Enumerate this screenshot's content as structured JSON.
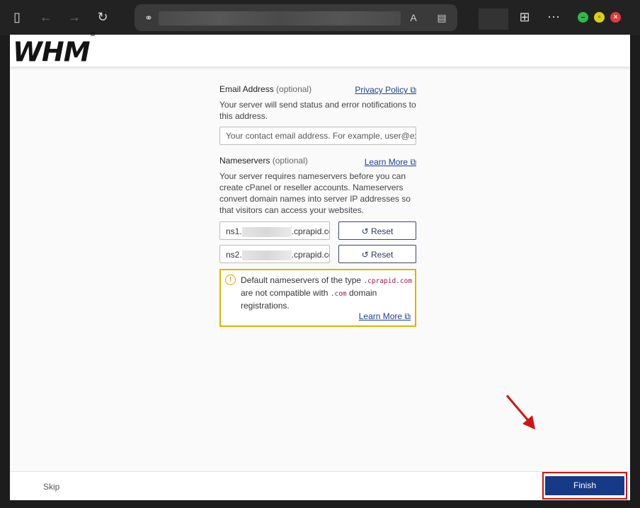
{
  "colors": {
    "accent": "#163a86",
    "link": "#1d3f8e",
    "warning_border": "#e0b100",
    "annotation_red": "#d21414"
  },
  "chrome": {
    "icons": [
      "sidebar-icon",
      "back-icon",
      "forward-icon",
      "refresh-icon",
      "link-icon",
      "translate-icon",
      "reader-icon",
      "extensions-icon",
      "more-icon"
    ]
  },
  "header": {
    "logo_text": "WHM",
    "logo_mark": "®"
  },
  "email": {
    "label": "Email Address",
    "optional": "(optional)",
    "privacy_link": "Privacy Policy",
    "help": "Your server will send status and error notifications to this address.",
    "placeholder": "Your contact email address. For example, user@ex"
  },
  "nameservers": {
    "label": "Nameservers",
    "optional": "(optional)",
    "learn_more": "Learn More",
    "help": "Your server requires nameservers before you can create cPanel or reseller accounts. Nameservers convert domain names into server IP addresses so that visitors can access your websites.",
    "rows": [
      {
        "prefix": "ns1.",
        "suffix": ".cprapid.com",
        "reset_label": "Reset"
      },
      {
        "prefix": "ns2.",
        "suffix": ".cprapid.com",
        "reset_label": "Reset"
      }
    ]
  },
  "warning": {
    "text_1": "Default nameservers of the type",
    "code_1": ".cprapid.com",
    "text_2": "are not compatible with",
    "code_2": ".com",
    "text_3": "domain registrations.",
    "learn_more": "Learn More"
  },
  "footer": {
    "skip": "Skip",
    "finish": "Finish"
  }
}
